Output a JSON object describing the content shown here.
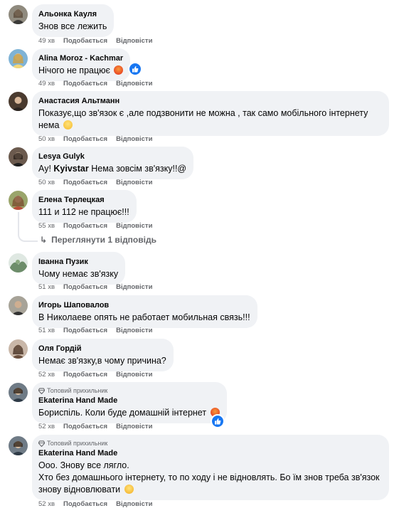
{
  "actions": {
    "like": "Подобається",
    "reply": "Відповісти"
  },
  "comments": [
    {
      "author": "Альонка Кауля",
      "text": "Знов все лежить",
      "time": "49 хв"
    },
    {
      "author": "Alina Moroz - Kachmar",
      "text": "Нічого не працює",
      "time": "49 хв"
    },
    {
      "author": "Анастасия Альтманн",
      "text": "Показує,що зв'язок є ,але подзвонити не можна , так само мобільного інтернету нема",
      "time": "50 хв"
    },
    {
      "author": "Lesya Gulyk",
      "text_before": "Ау! ",
      "text_bold": "Kyivstar",
      "text_after": " Нема зовсім зв'язку!!@",
      "time": "50 хв"
    },
    {
      "author": "Елена Терлецкая",
      "text": "111 и 112 не працює!!!",
      "time": "55 хв",
      "replies_label": "Переглянути 1 відповідь"
    },
    {
      "author": "Іванна Пузик",
      "text": "Чому немає зв'язку",
      "time": "51 хв"
    },
    {
      "author": "Игорь Шаповалов",
      "text": "В Николаеве опять не работает мобильная связь!!!",
      "time": "51 хв"
    },
    {
      "author": "Оля Гордій",
      "text": "Немає зв'язку,в чому причина?",
      "time": "52 хв"
    },
    {
      "badge": "Топовий прихильник",
      "author": "Ekaterina Hand Made",
      "text": "Бориспіль. Коли буде домашній інтернет",
      "time": "52 хв"
    },
    {
      "badge": "Топовий прихильник",
      "author": "Ekaterina Hand Made",
      "text": "Ооо. Зновy все лягло.\nХто без домашнього інтернету, то по ходу і не відновлять. Бо їм знов треба зв'язок знову відновлювати",
      "time": "52 хв"
    }
  ],
  "icons": {
    "reply_arrow": "reply-arrow-icon",
    "badge": "diamond-badge-icon",
    "like_reaction": "like-reaction-icon"
  },
  "colors": {
    "bubble": "#f0f2f5",
    "meta_text": "#65676b",
    "text": "#050505",
    "like_blue": "#1877f2"
  }
}
